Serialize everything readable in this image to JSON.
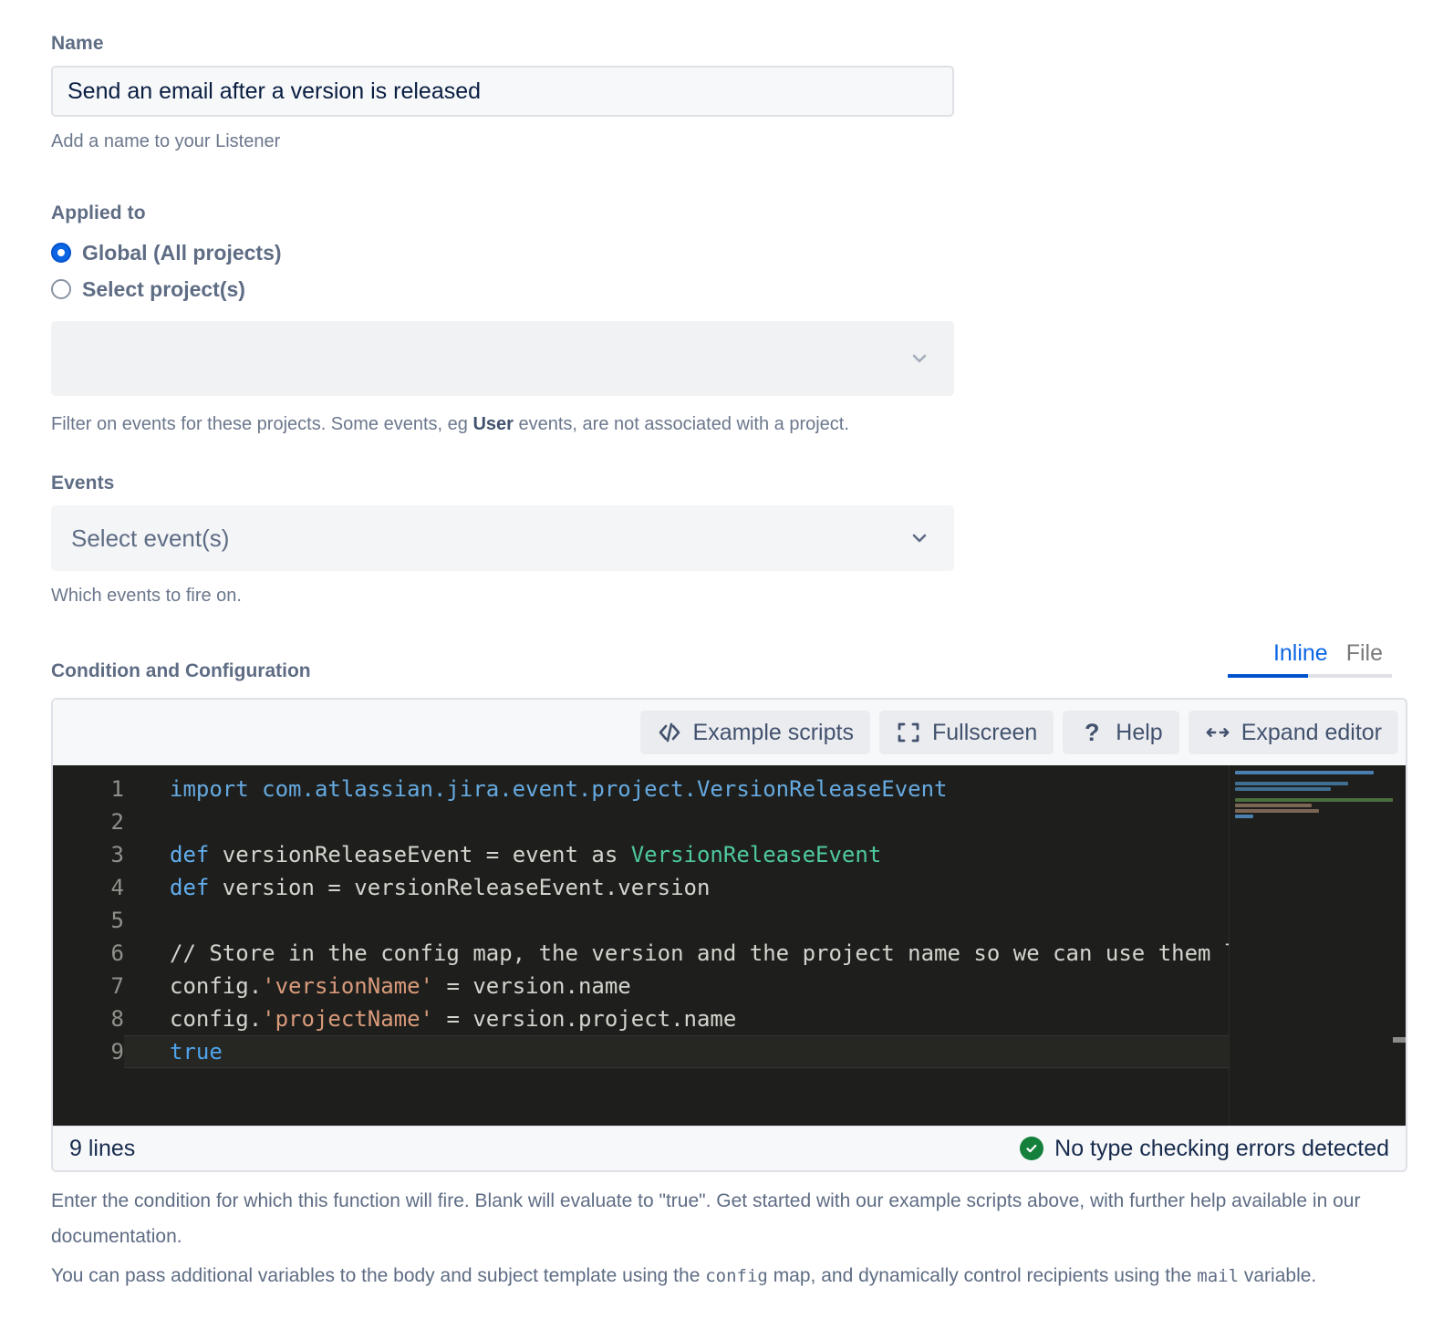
{
  "name_section": {
    "label": "Name",
    "value": "Send an email after a version is released",
    "placeholder": "",
    "help": "Add a name to your Listener"
  },
  "applied_to": {
    "label": "Applied to",
    "options": [
      {
        "label": "Global (All projects)",
        "selected": true
      },
      {
        "label": "Select project(s)",
        "selected": false
      }
    ],
    "project_select": {
      "value": "",
      "placeholder": ""
    },
    "help_pre": "Filter on events for these projects. Some events, eg ",
    "help_bold": "User",
    "help_post": " events, are not associated with a project."
  },
  "events_section": {
    "label": "Events",
    "select_placeholder": "Select event(s)",
    "help": "Which events to fire on."
  },
  "condition": {
    "title": "Condition and Configuration",
    "tabs": [
      {
        "label": "Inline",
        "active": true
      },
      {
        "label": "File",
        "active": false
      }
    ],
    "toolbar": [
      {
        "label": "Example scripts",
        "icon": "code-brackets-icon"
      },
      {
        "label": "Fullscreen",
        "icon": "fullscreen-icon"
      },
      {
        "label": "Help",
        "icon": "question-mark-icon"
      },
      {
        "label": "Expand editor",
        "icon": "expand-arrows-icon"
      }
    ]
  },
  "editor": {
    "language": "groovy",
    "theme_background": "#1E1F1C",
    "active_line": 9,
    "lines": [
      {
        "n": "1",
        "text": "import com.atlassian.jira.event.project.VersionReleaseEvent"
      },
      {
        "n": "2",
        "text": ""
      },
      {
        "n": "3",
        "text": "def versionReleaseEvent = event as VersionReleaseEvent"
      },
      {
        "n": "4",
        "text": "def version = versionReleaseEvent.version"
      },
      {
        "n": "5",
        "text": ""
      },
      {
        "n": "6",
        "text": "// Store in the config map, the version and the project name so we can use them later"
      },
      {
        "n": "7",
        "text": "config.'versionName' = version.name"
      },
      {
        "n": "8",
        "text": "config.'projectName' = version.project.name"
      },
      {
        "n": "9",
        "text": "true"
      }
    ],
    "status_left": "9 lines",
    "status_right": "No type checking errors detected"
  },
  "footer": {
    "para1": "Enter the condition for which this function will fire. Blank will evaluate to \"true\". Get started with our example scripts above, with further help available in our documentation.",
    "para2_a": "You can pass additional variables to the body and subject template using the ",
    "para2_code1": "config",
    "para2_b": " map, and dynamically control recipients using the ",
    "para2_code2": "mail",
    "para2_c": " variable."
  },
  "colors": {
    "accent": "#0C66E4",
    "label": "#5E6C84",
    "success": "#14803C",
    "input_bg": "#F7F8F9",
    "border": "#DFE1E6"
  }
}
